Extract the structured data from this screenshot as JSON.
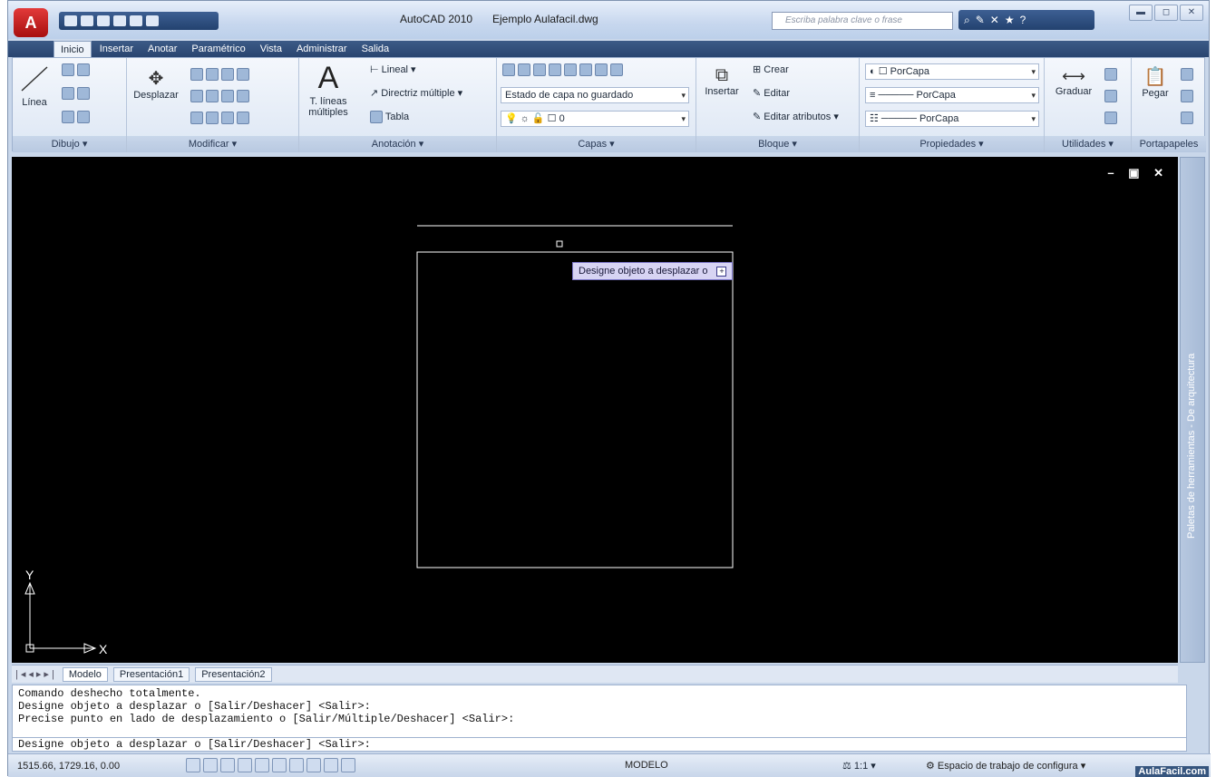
{
  "app": {
    "title": "AutoCAD 2010",
    "file": "Ejemplo Aulafacil.dwg"
  },
  "search": {
    "placeholder": "Escriba palabra clave o frase"
  },
  "tabs": [
    "Inicio",
    "Insertar",
    "Anotar",
    "Paramétrico",
    "Vista",
    "Administrar",
    "Salida"
  ],
  "ribbon": {
    "dibujo": {
      "title": "Dibujo",
      "linea": "Línea"
    },
    "modificar": {
      "title": "Modificar",
      "desplazar": "Desplazar"
    },
    "anotacion": {
      "title": "Anotación",
      "tlineas1": "T. líneas",
      "tlineas2": "múltiples",
      "lineal": "Lineal",
      "directriz": "Directriz múltiple",
      "tabla": "Tabla"
    },
    "capas": {
      "title": "Capas",
      "estado": "Estado de capa no guardado",
      "capa0": "0"
    },
    "bloque": {
      "title": "Bloque",
      "insertar": "Insertar",
      "crear": "Crear",
      "editar": "Editar",
      "editar_atributos": "Editar atributos"
    },
    "propiedades": {
      "title": "Propiedades",
      "color": "PorCapa",
      "linetype": "PorCapa",
      "lineweight": "PorCapa"
    },
    "utilidades": {
      "title": "Utilidades",
      "graduar": "Graduar"
    },
    "portapapeles": {
      "title": "Portapapeles",
      "pegar": "Pegar"
    }
  },
  "canvas": {
    "tooltip": "Designe objeto a desplazar o",
    "ucs_x": "X",
    "ucs_y": "Y"
  },
  "palette": {
    "label": "Paletas de herramientas - De arquitectura"
  },
  "layout_tabs": [
    "Modelo",
    "Presentación1",
    "Presentación2"
  ],
  "command": {
    "lines": [
      "Comando deshecho totalmente.",
      "Designe objeto a desplazar o [Salir/Deshacer] <Salir>:",
      "Precise punto en lado de desplazamiento o [Salir/Múltiple/Deshacer] <Salir>:"
    ],
    "prompt": "Designe objeto a desplazar o [Salir/Deshacer] <Salir>:"
  },
  "status": {
    "coords": "1515.66, 1729.16, 0.00",
    "space": "MODELO",
    "scale": "1:1",
    "workspace": "Espacio de trabajo de configura"
  },
  "watermark": "AulaFacil.com"
}
